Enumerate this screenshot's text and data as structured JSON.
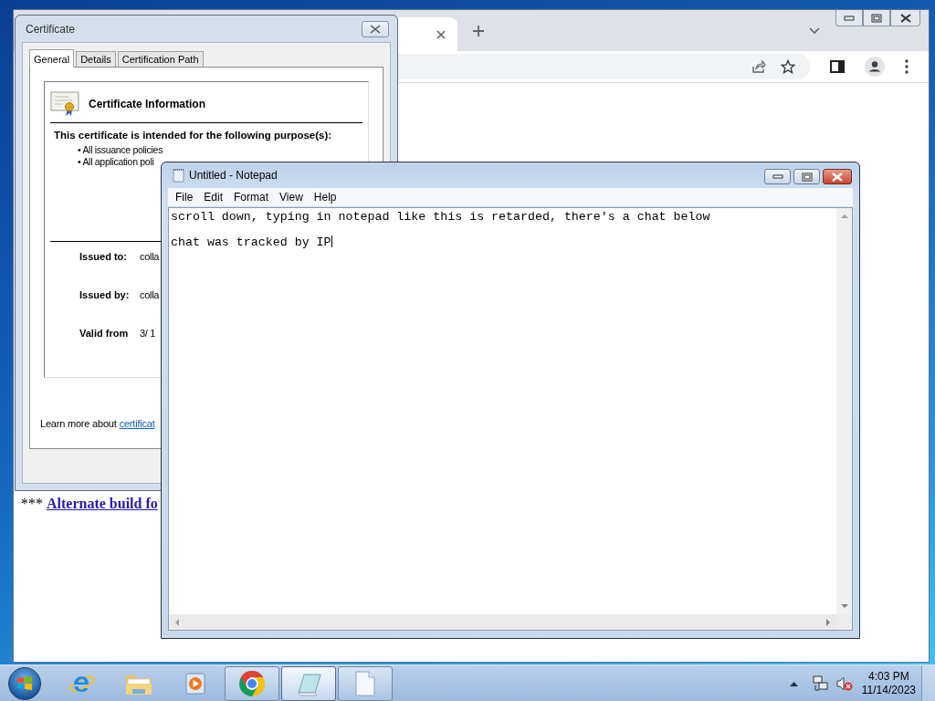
{
  "browser": {
    "content": {
      "prefix": "***",
      "link": "Alternate build fo"
    }
  },
  "certificate_dialog": {
    "title": "Certificate",
    "tabs": [
      {
        "label": "General",
        "selected": true
      },
      {
        "label": "Details",
        "selected": false
      },
      {
        "label": "Certification Path",
        "selected": false
      }
    ],
    "heading": "Certificate Information",
    "purpose_heading": "This certificate is intended for the following purpose(s):",
    "purposes": [
      "• All issuance policies",
      "• All application poli"
    ],
    "fields": [
      {
        "label": "Issued to:",
        "value": "colla"
      },
      {
        "label": "Issued by:",
        "value": "colla"
      },
      {
        "label": "Valid from",
        "value": "3/ 1"
      }
    ],
    "learn_more": "Learn more about",
    "learn_more_link": "certificat"
  },
  "notepad": {
    "title": "Untitled - Notepad",
    "menu": [
      "File",
      "Edit",
      "Format",
      "View",
      "Help"
    ],
    "lines": [
      "scroll down, typing in notepad like this is retarded, there's a chat below",
      "chat was tracked by IP"
    ]
  },
  "taskbar": {
    "apps": [
      {
        "kind": "ie",
        "running": false,
        "selected": false
      },
      {
        "kind": "folder",
        "running": false,
        "selected": false
      },
      {
        "kind": "media",
        "running": false,
        "selected": false
      },
      {
        "kind": "browser",
        "running": true,
        "selected": false
      },
      {
        "kind": "notepad",
        "running": true,
        "selected": true
      },
      {
        "kind": "document",
        "running": true,
        "selected": false
      }
    ],
    "clock": {
      "time": "4:03 PM",
      "date": "11/14/2023"
    }
  }
}
